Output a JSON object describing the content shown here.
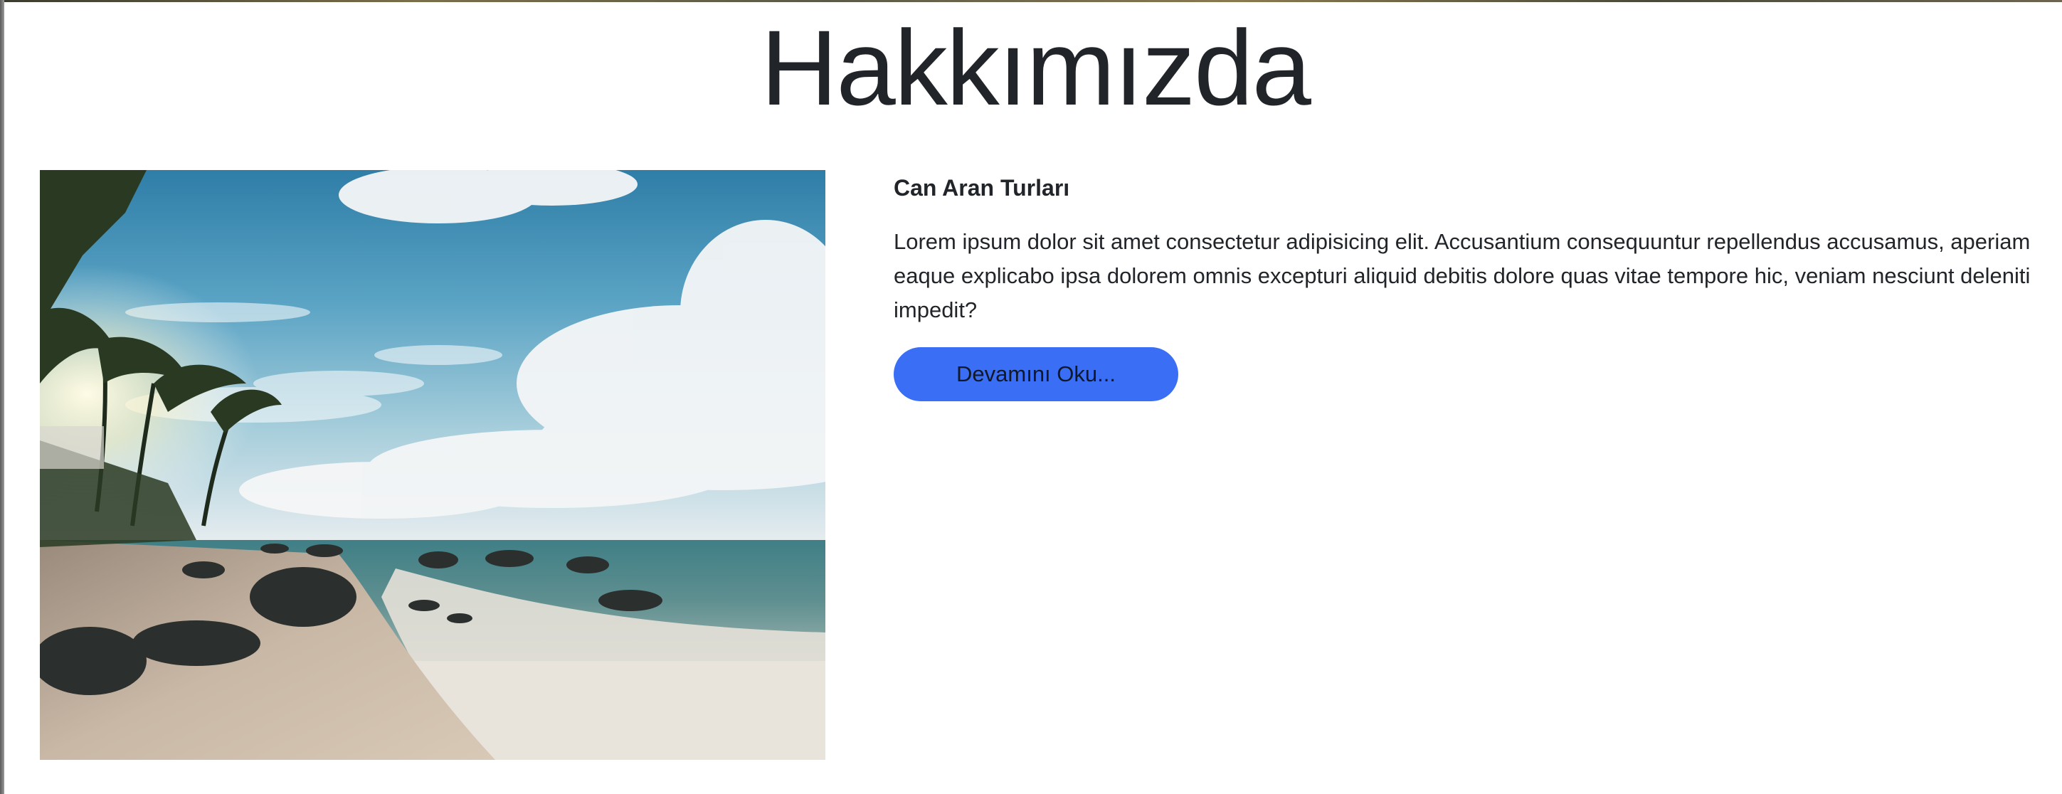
{
  "section": {
    "title": "Hakkımızda"
  },
  "about": {
    "image": "beach-photo",
    "heading": "Can Aran Turları",
    "paragraph": "Lorem ipsum dolor sit amet consectetur adipisicing elit. Accusantium consequuntur repellendus accusamus, aperiam eaque explicabo ipsa dolorem omnis excepturi aliquid debitis dolore quas vitae tempore hic, veniam nesciunt deleniti impedit?",
    "button_label": "Devamını Oku..."
  },
  "colors": {
    "button_bg": "#3a6ff5",
    "text": "#212529",
    "background": "#ffffff"
  }
}
